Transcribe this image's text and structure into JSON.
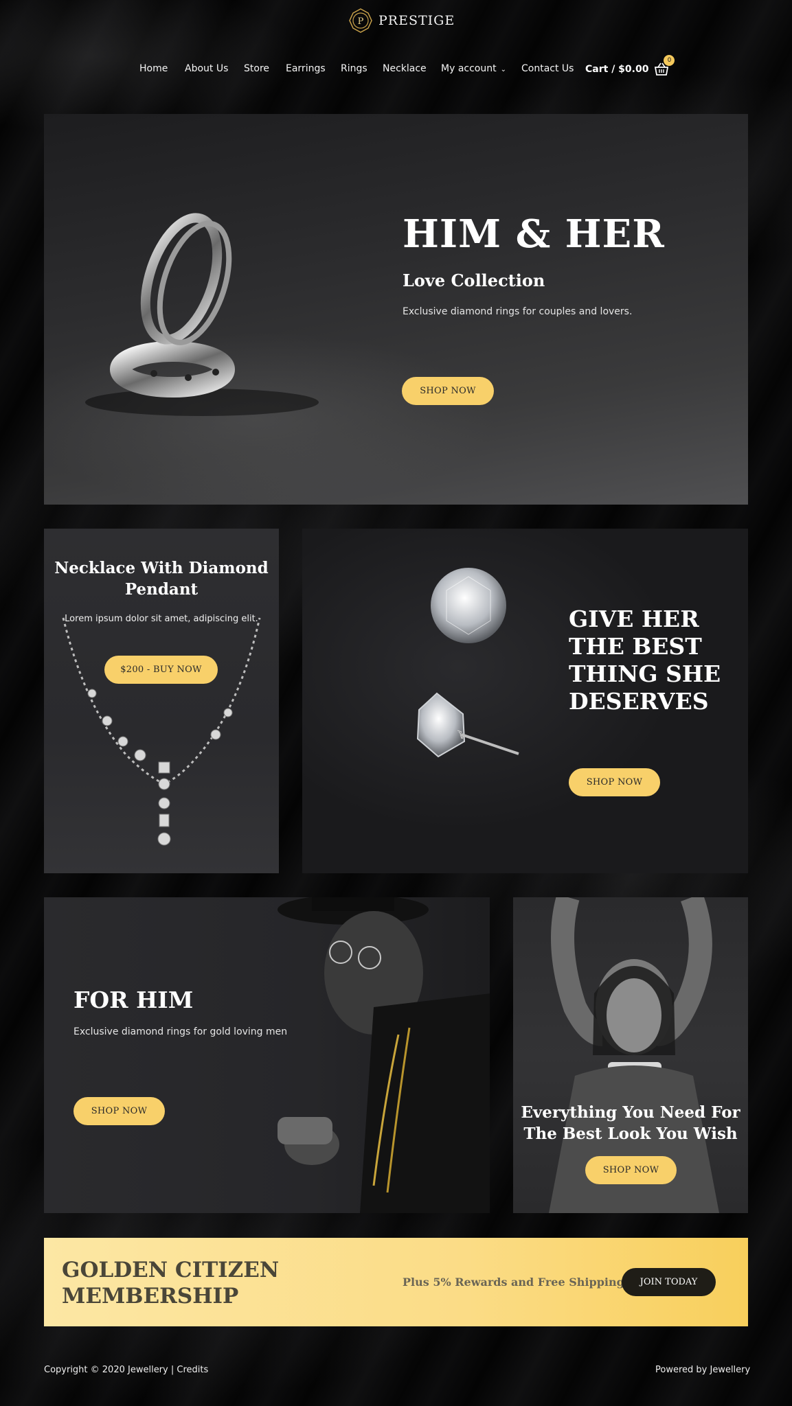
{
  "header": {
    "logo_letter": "P",
    "logo_text": "PRESTIGE",
    "nav": [
      "Home",
      "About Us",
      "Store",
      "Earrings",
      "Rings",
      "Necklace",
      "My account",
      "Contact Us"
    ],
    "cart_label": "Cart / $0.00",
    "cart_count": "0"
  },
  "hero": {
    "title": "HIM & HER",
    "subtitle": "Love Collection",
    "description": "Exclusive diamond rings for couples and lovers.",
    "button": "SHOP NOW"
  },
  "necklace": {
    "title_line1": "Necklace With Diamond",
    "title_line2": "Pendant",
    "description": "Lorem ipsum dolor sit amet, adipiscing elit.",
    "button": "$200 - BUY NOW"
  },
  "earrings": {
    "title_lines": [
      "GIVE HER",
      "THE BEST",
      "THING SHE",
      "DESERVES"
    ],
    "button": "SHOP NOW"
  },
  "for_him": {
    "title": "FOR HIM",
    "description": "Exclusive diamond rings for gold loving men",
    "button": "SHOP NOW"
  },
  "woman": {
    "title_line1": "Everything You Need For",
    "title_line2": "The Best Look You Wish",
    "button": "SHOP NOW"
  },
  "membership": {
    "title_line1": "GOLDEN CITIZEN",
    "title_line2": "MEMBERSHIP",
    "offer": "Plus 5% Rewards and Free Shipping",
    "button": "JOIN TODAY"
  },
  "footer": {
    "copyright": "Copyright © 2020 Jewellery | ",
    "credits": "Credits",
    "powered": "Powered by Jewellery"
  },
  "colors": {
    "accent": "#f8d06a",
    "background": "#050505",
    "card": "#2a2a2d",
    "banner": "#fbdc86"
  }
}
